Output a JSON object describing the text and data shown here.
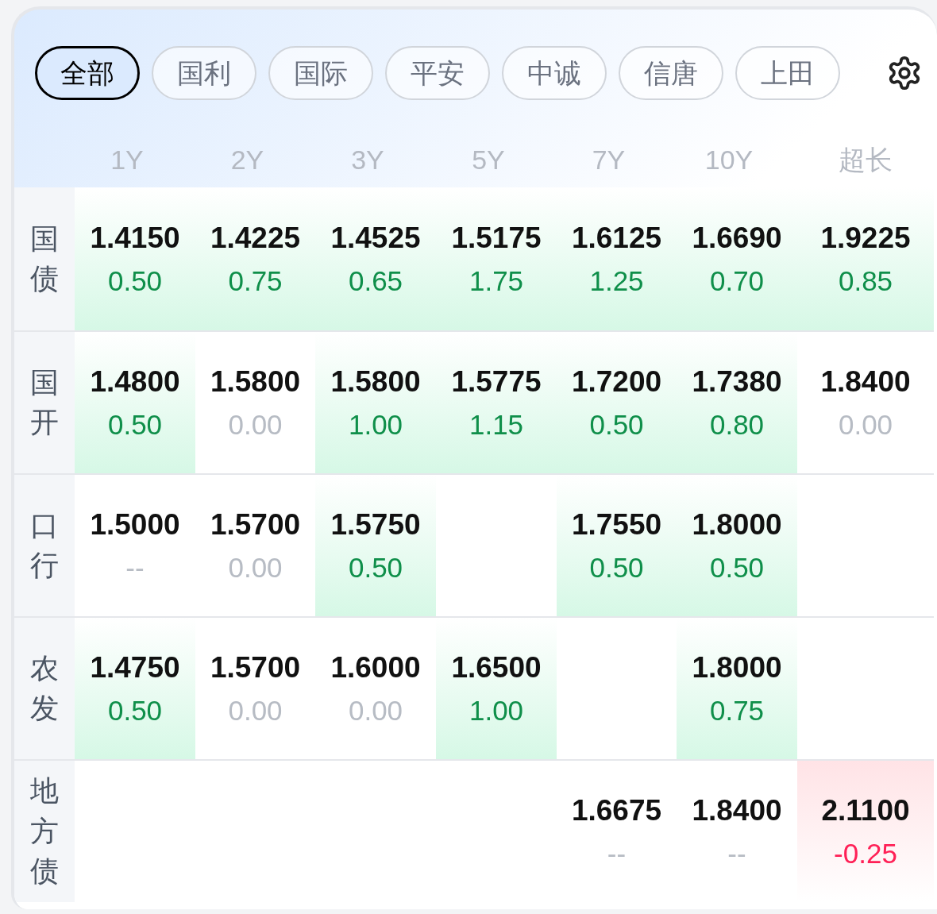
{
  "tabs": [
    {
      "label": "全部",
      "selected": true
    },
    {
      "label": "国利",
      "selected": false
    },
    {
      "label": "国际",
      "selected": false
    },
    {
      "label": "平安",
      "selected": false
    },
    {
      "label": "中诚",
      "selected": false
    },
    {
      "label": "信唐",
      "selected": false
    },
    {
      "label": "上田",
      "selected": false
    }
  ],
  "columns": [
    "1Y",
    "2Y",
    "3Y",
    "5Y",
    "7Y",
    "10Y",
    "超长"
  ],
  "rows": [
    {
      "label": "国债",
      "cells": [
        {
          "yield": "1.4150",
          "change": "0.50",
          "kind": "up"
        },
        {
          "yield": "1.4225",
          "change": "0.75",
          "kind": "up"
        },
        {
          "yield": "1.4525",
          "change": "0.65",
          "kind": "up"
        },
        {
          "yield": "1.5175",
          "change": "1.75",
          "kind": "up"
        },
        {
          "yield": "1.6125",
          "change": "1.25",
          "kind": "up"
        },
        {
          "yield": "1.6690",
          "change": "0.70",
          "kind": "up"
        },
        {
          "yield": "1.9225",
          "change": "0.85",
          "kind": "up"
        }
      ]
    },
    {
      "label": "国开",
      "cells": [
        {
          "yield": "1.4800",
          "change": "0.50",
          "kind": "up"
        },
        {
          "yield": "1.5800",
          "change": "0.00",
          "kind": "flat"
        },
        {
          "yield": "1.5800",
          "change": "1.00",
          "kind": "up"
        },
        {
          "yield": "1.5775",
          "change": "1.15",
          "kind": "up"
        },
        {
          "yield": "1.7200",
          "change": "0.50",
          "kind": "up"
        },
        {
          "yield": "1.7380",
          "change": "0.80",
          "kind": "up"
        },
        {
          "yield": "1.8400",
          "change": "0.00",
          "kind": "flat"
        }
      ]
    },
    {
      "label": "口行",
      "cells": [
        {
          "yield": "1.5000",
          "change": "--",
          "kind": "flat"
        },
        {
          "yield": "1.5700",
          "change": "0.00",
          "kind": "flat"
        },
        {
          "yield": "1.5750",
          "change": "0.50",
          "kind": "up"
        },
        null,
        {
          "yield": "1.7550",
          "change": "0.50",
          "kind": "up"
        },
        {
          "yield": "1.8000",
          "change": "0.50",
          "kind": "up"
        },
        null
      ]
    },
    {
      "label": "农发",
      "cells": [
        {
          "yield": "1.4750",
          "change": "0.50",
          "kind": "up"
        },
        {
          "yield": "1.5700",
          "change": "0.00",
          "kind": "flat"
        },
        {
          "yield": "1.6000",
          "change": "0.00",
          "kind": "flat"
        },
        {
          "yield": "1.6500",
          "change": "1.00",
          "kind": "up"
        },
        null,
        {
          "yield": "1.8000",
          "change": "0.75",
          "kind": "up"
        },
        null
      ]
    },
    {
      "label": "地方债",
      "cells": [
        null,
        null,
        null,
        null,
        {
          "yield": "1.6675",
          "change": "--",
          "kind": "flat"
        },
        {
          "yield": "1.8400",
          "change": "--",
          "kind": "flat"
        },
        {
          "yield": "2.1100",
          "change": "-0.25",
          "kind": "down"
        }
      ]
    }
  ]
}
